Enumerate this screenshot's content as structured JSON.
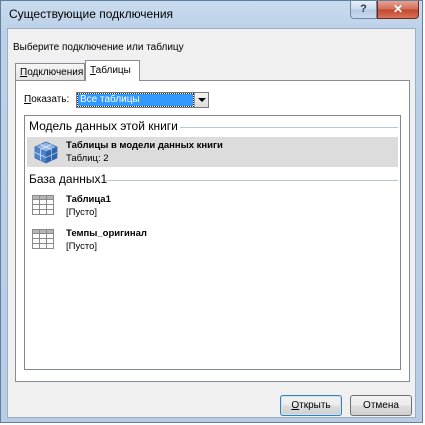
{
  "window": {
    "title": "Существующие подключения",
    "help_glyph": "?",
    "close_glyph": "✕"
  },
  "prompt": "Выберите подключение или таблицу",
  "tabs": [
    {
      "label_ul": "П",
      "label_rest": "одключения",
      "selected": false
    },
    {
      "label_ul": "Т",
      "label_rest": "аблицы",
      "selected": true
    }
  ],
  "filter": {
    "label_ul": "П",
    "label_rest": "оказать:",
    "value": "Все таблицы"
  },
  "groups": [
    {
      "header": "Модель данных этой книги",
      "items": [
        {
          "title": "Таблицы в модели данных книги",
          "subtitle": "Таблиц: 2",
          "icon": "data-model-cube-icon",
          "selected": true
        }
      ]
    },
    {
      "header": "База данных1",
      "items": [
        {
          "title": "Таблица1",
          "subtitle": "[Пусто]",
          "icon": "table-grid-icon",
          "selected": false
        },
        {
          "title": "Темпы_оригинал",
          "subtitle": "[Пусто]",
          "icon": "table-grid-icon",
          "selected": false
        }
      ]
    }
  ],
  "buttons": {
    "open_ul": "О",
    "open_rest": "ткрыть",
    "cancel": "Отмена"
  },
  "colors": {
    "selection": "#3399ff",
    "selected_item": "#dcdcdc",
    "close_button": "#c0452c"
  }
}
